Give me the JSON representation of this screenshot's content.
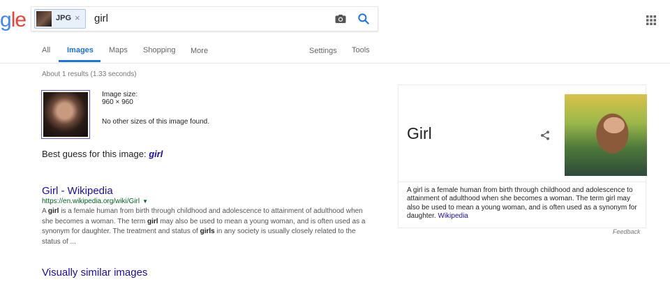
{
  "logo": {
    "text_blue": "g",
    "text_red": "le"
  },
  "search": {
    "chip_label": "JPG",
    "chip_close": "×",
    "query": "girl"
  },
  "tabs": [
    {
      "label": "All"
    },
    {
      "label": "Images"
    },
    {
      "label": "Maps"
    },
    {
      "label": "Shopping"
    },
    {
      "label": "More"
    },
    {
      "label": "Settings"
    },
    {
      "label": "Tools"
    }
  ],
  "results": {
    "stats": "About 1 results (1.33 seconds)",
    "image_size_label": "Image size:",
    "image_size_value": "960 × 960",
    "no_other_sizes": "No other sizes of this image found.",
    "best_guess_prefix": "Best guess for this image: ",
    "best_guess_term": "girl",
    "result": {
      "title": "Girl - Wikipedia",
      "url": "https://en.wikipedia.org/wiki/Girl",
      "url_arrow": "▼",
      "snippet": [
        {
          "text": "A ",
          "bold": false
        },
        {
          "text": "girl",
          "bold": true
        },
        {
          "text": " is a female human from birth through childhood and adolescence to attainment of adulthood when she becomes a woman. The term ",
          "bold": false
        },
        {
          "text": "girl",
          "bold": true
        },
        {
          "text": " may also be used to mean a young woman, and is often used as a synonym for daughter. The treatment and status of ",
          "bold": false
        },
        {
          "text": "girls",
          "bold": true
        },
        {
          "text": " in any society is usually closely related to the status of ...",
          "bold": false
        }
      ]
    },
    "similar_heading": "Visually similar images"
  },
  "knowledge_panel": {
    "title": "Girl",
    "description": "A girl is a female human from birth through childhood and adolescence to attainment of adulthood when she becomes a woman. The term girl may also be used to mean a young woman, and is often used as a synonym for daughter.",
    "source": "Wikipedia",
    "feedback": "Feedback"
  },
  "colors": {
    "accent": "#1a73e8",
    "link": "#1a0dab",
    "url": "#006621"
  }
}
